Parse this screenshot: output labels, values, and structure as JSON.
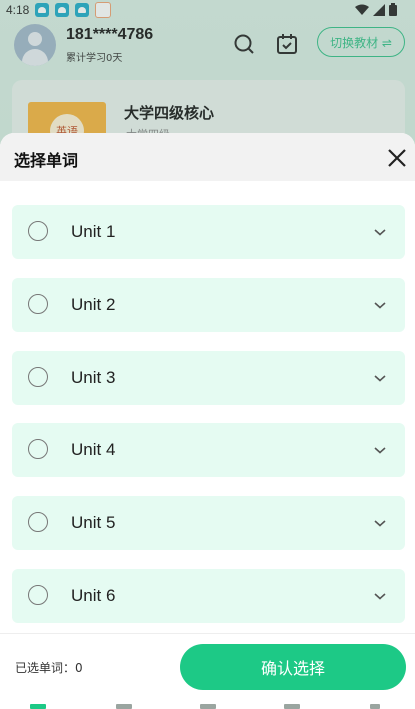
{
  "status_bar": {
    "time": "4:18",
    "app_icons": [
      "ghost-app-icon",
      "ghost-app-icon",
      "ghost-app-icon",
      "heart-app-icon"
    ],
    "indicators": [
      "wifi-icon",
      "signal-icon",
      "battery-icon"
    ]
  },
  "profile": {
    "phone": "181****4786",
    "study_days": "累计学习0天",
    "switch_button": "切换教材 ⇌"
  },
  "book": {
    "cover_label": "英语",
    "title": "大学四级核心",
    "subtitle": "大学四级"
  },
  "sheet": {
    "title": "选择单词",
    "units": [
      {
        "label": "Unit 1",
        "selected": false
      },
      {
        "label": "Unit 2",
        "selected": false
      },
      {
        "label": "Unit 3",
        "selected": false
      },
      {
        "label": "Unit 4",
        "selected": false
      },
      {
        "label": "Unit 5",
        "selected": false
      },
      {
        "label": "Unit 6",
        "selected": false
      }
    ],
    "selected_count": "已选单词：0",
    "confirm_button": "确认选择"
  },
  "colors": {
    "accent": "#1dc986",
    "row_bg": "#e5fbf2",
    "header_bg": "#f2f2f2"
  }
}
